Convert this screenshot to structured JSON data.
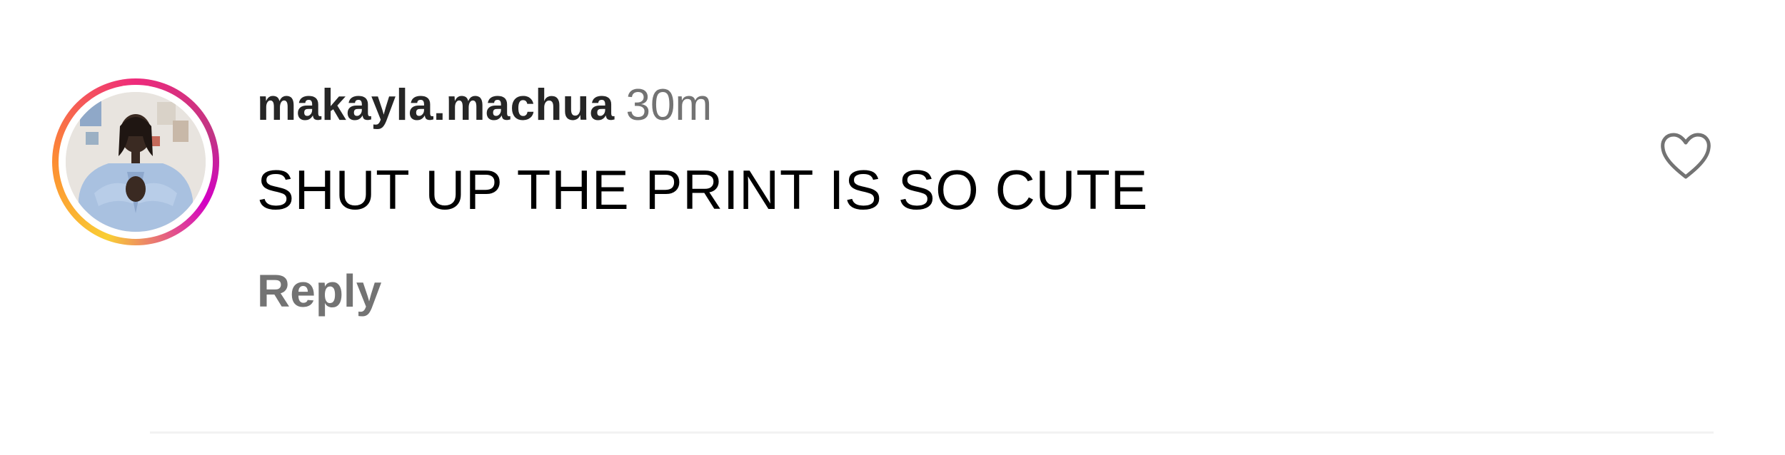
{
  "comment": {
    "username": "makayla.machua",
    "timestamp": "30m",
    "text": "SHUT UP THE PRINT IS SO CUTE",
    "reply_label": "Reply",
    "like_icon": "heart-outline-icon",
    "avatar_has_story_ring": true
  },
  "colors": {
    "username": "#262626",
    "secondary_text": "#737373",
    "comment_text": "#000000",
    "story_ring_start": "#f9ce34",
    "story_ring_mid": "#ee2a7b",
    "story_ring_end": "#d300c5",
    "divider": "#f2f2f2"
  }
}
